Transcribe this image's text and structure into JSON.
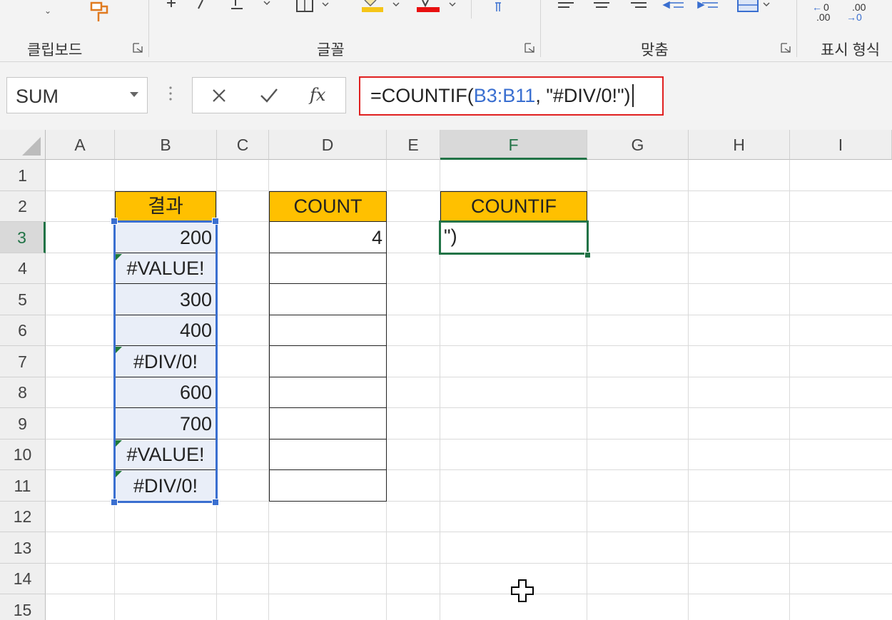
{
  "ribbon": {
    "groups": [
      {
        "label": "클립보드"
      },
      {
        "label": "글꼴"
      },
      {
        "label": "맞춤"
      },
      {
        "label": "표시 형식"
      }
    ],
    "colors": {
      "highlight": "#f5c518",
      "font_color": "#e81010"
    },
    "number_format_icons": {
      "increase": ".00",
      "increase_prefix": "0",
      "decrease": ".00"
    }
  },
  "formula_bar": {
    "name_box": "SUM",
    "formula_prefix": "=COUNTIF(",
    "formula_ref": "B3:B11",
    "formula_suffix": ", \"#DIV/0!\")",
    "fx_label": "fx"
  },
  "sheet": {
    "columns": [
      "A",
      "B",
      "C",
      "D",
      "E",
      "F",
      "G",
      "H",
      "I"
    ],
    "rows": [
      "1",
      "2",
      "3",
      "4",
      "5",
      "6",
      "7",
      "8",
      "9",
      "10",
      "11",
      "12",
      "13",
      "14",
      "15"
    ],
    "active_column": "F",
    "active_row": "3",
    "header_b": "결과",
    "header_d": "COUNT",
    "header_f": "COUNTIF",
    "results": [
      "200",
      "#VALUE!",
      "300",
      "400",
      "#DIV/0!",
      "600",
      "700",
      "#VALUE!",
      "#DIV/0!"
    ],
    "count_value": "4",
    "countif_entry": "\")"
  }
}
